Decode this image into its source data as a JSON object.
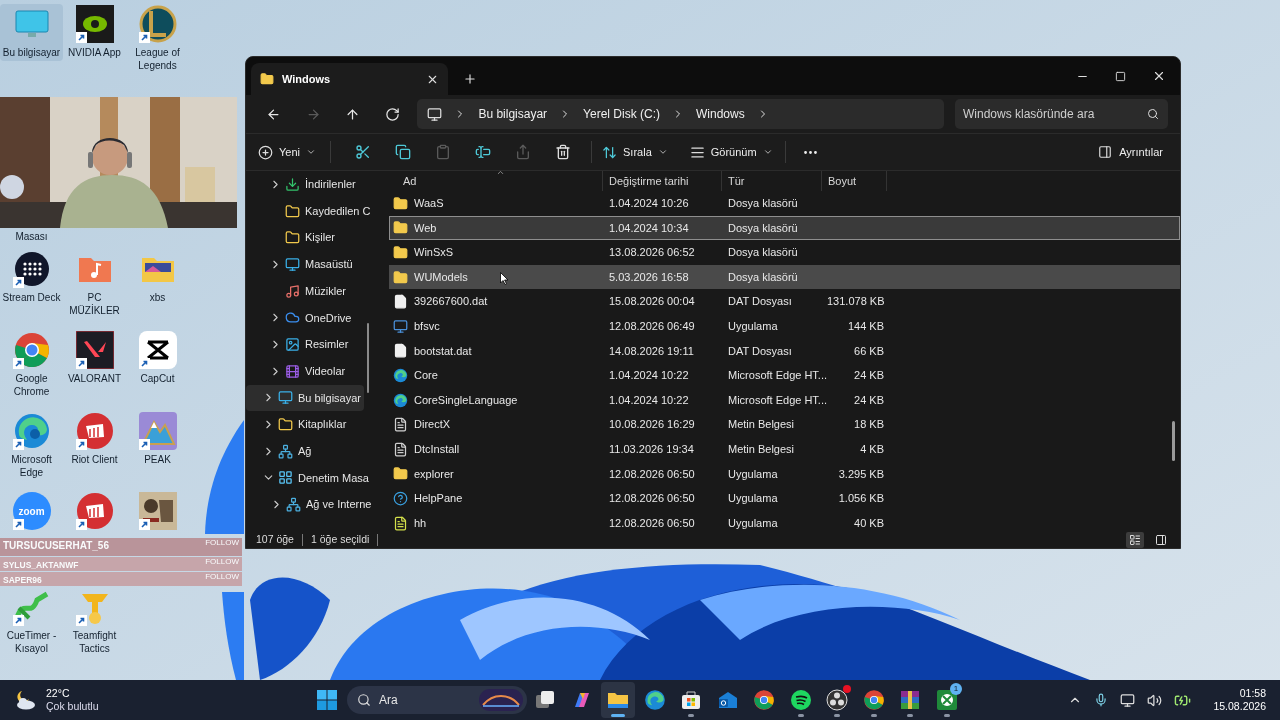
{
  "desktop": {
    "rows": [
      {
        "icons": [
          {
            "label": "Bu bilgisayar",
            "kind": "monitor",
            "shortcut": false,
            "selected": true
          },
          {
            "label": "NVIDIA App",
            "kind": "nvidia",
            "shortcut": true,
            "selected": false
          },
          {
            "label": "League of Legends",
            "kind": "emblem",
            "shortcut": true,
            "selected": false
          }
        ]
      },
      {
        "icons": []
      },
      {
        "icons": [
          {
            "label": "Masası",
            "kind": "none"
          }
        ]
      },
      {
        "icons": [
          {
            "label": "Stream Deck",
            "kind": "dotgrid",
            "shortcut": true,
            "selected": false
          },
          {
            "label": "PC MÜZİKLER",
            "kind": "musicfolder",
            "shortcut": false,
            "selected": false
          },
          {
            "label": "xbs",
            "kind": "imagefolder",
            "shortcut": false,
            "selected": false
          }
        ]
      },
      {
        "icons": [
          {
            "label": "Google Chrome",
            "kind": "chrome",
            "shortcut": true,
            "selected": false
          },
          {
            "label": "VALORANT",
            "kind": "valorant",
            "shortcut": true,
            "selected": false
          },
          {
            "label": "CapCut",
            "kind": "capcut",
            "shortcut": true,
            "selected": false
          }
        ]
      },
      {
        "icons": [
          {
            "label": "Microsoft Edge",
            "kind": "edge",
            "shortcut": true,
            "selected": false
          },
          {
            "label": "Riot Client",
            "kind": "riot",
            "shortcut": true,
            "selected": false
          },
          {
            "label": "PEAK",
            "kind": "mountain",
            "shortcut": true,
            "selected": false
          }
        ]
      },
      {
        "icons": [
          {
            "kind": "zoom",
            "logo_text": "zoom",
            "shortcut": true,
            "selected": false
          },
          {
            "kind": "riot",
            "shortcut": true,
            "selected": false
          },
          {
            "kind": "gameart",
            "shortcut": true,
            "selected": false
          }
        ]
      },
      {
        "icons": [
          {
            "label": "CueTimer - Kısayol",
            "kind": "cuetimer",
            "shortcut": true,
            "selected": false
          },
          {
            "label": "Teamfight Tactics",
            "kind": "goldlogo",
            "shortcut": true,
            "selected": false
          }
        ]
      }
    ]
  },
  "follow_alerts": [
    {
      "name": "TURSUCUSERHAT_56",
      "action": "FOLLOW"
    },
    {
      "name": "SYLUS_AKTANWF",
      "action": "FOLLOW"
    },
    {
      "name": "SAPER96",
      "action": "FOLLOW"
    }
  ],
  "explorer": {
    "tab": {
      "title": "Windows"
    },
    "nav_buttons": [
      {
        "kind": "back",
        "disabled": false
      },
      {
        "kind": "forward",
        "disabled": true
      },
      {
        "kind": "up",
        "disabled": false
      },
      {
        "kind": "refresh",
        "disabled": false
      }
    ],
    "breadcrumb": [
      "Bu bilgisayar",
      "Yerel Disk (C:)",
      "Windows"
    ],
    "search": {
      "placeholder": "Windows klasöründe ara"
    },
    "toolbar": {
      "new": "Yeni",
      "tools": [
        {
          "kind": "cut",
          "disabled": false
        },
        {
          "kind": "copy",
          "disabled": false
        },
        {
          "kind": "paste",
          "disabled": true
        },
        {
          "kind": "rename",
          "disabled": false
        },
        {
          "kind": "share",
          "disabled": true
        },
        {
          "kind": "delete",
          "disabled": false
        }
      ],
      "sort": "Sırala",
      "view": "Görünüm",
      "details": "Ayrıntılar"
    },
    "nav_pane": {
      "pinned": [
        {
          "label": "İndirilenler",
          "kind": "download",
          "expandable": true,
          "expanded": false,
          "selected": false
        },
        {
          "label": "Kaydedilen C",
          "kind": "folder",
          "expandable": false,
          "selected": false
        },
        {
          "label": "Kişiler",
          "kind": "folder",
          "expandable": false,
          "selected": false
        },
        {
          "label": "Masaüstü",
          "kind": "desktop",
          "expandable": true,
          "expanded": false,
          "selected": false
        },
        {
          "label": "Müzikler",
          "kind": "music",
          "expandable": false,
          "selected": false
        },
        {
          "label": "OneDrive",
          "kind": "cloud",
          "expandable": true,
          "expanded": false,
          "selected": false
        },
        {
          "label": "Resimler",
          "kind": "pictures",
          "expandable": true,
          "expanded": false,
          "selected": false
        },
        {
          "label": "Videolar",
          "kind": "videos",
          "expandable": true,
          "expanded": false,
          "selected": false
        }
      ],
      "tree": [
        {
          "label": "Bu bilgisayar",
          "kind": "monitor",
          "expandable": true,
          "expanded": false,
          "selected": true
        },
        {
          "label": "Kitaplıklar",
          "kind": "folder",
          "expandable": true,
          "expanded": false,
          "selected": false
        },
        {
          "label": "Ağ",
          "kind": "network",
          "expandable": true,
          "expanded": false,
          "selected": false
        },
        {
          "label": "Denetim Masa",
          "kind": "control",
          "expandable": true,
          "expanded": true,
          "selected": false,
          "children": [
            {
              "label": "Ağ ve Interne",
              "kind": "network",
              "expandable": true,
              "expanded": false,
              "selected": false
            }
          ]
        }
      ]
    },
    "columns": [
      "Ad",
      "Değiştirme tarihi",
      "Tür",
      "Boyut"
    ],
    "rows": [
      {
        "name": "WaaS",
        "date": "1.04.2024 10:26",
        "type": "Dosya klasörü",
        "kind": "folder",
        "selected": false,
        "hovered": false
      },
      {
        "name": "Web",
        "date": "1.04.2024 10:34",
        "type": "Dosya klasörü",
        "kind": "folder",
        "selected": true,
        "hovered": false
      },
      {
        "name": "WinSxS",
        "date": "13.08.2026 06:52",
        "type": "Dosya klasörü",
        "kind": "folder",
        "selected": false,
        "hovered": false
      },
      {
        "name": "WUModels",
        "date": "5.03.2026 16:58",
        "type": "Dosya klasörü",
        "kind": "folder",
        "selected": false,
        "hovered": true
      },
      {
        "name": "392667600.dat",
        "date": "15.08.2026 00:04",
        "type": "DAT Dosyası",
        "size": "131.078 KB",
        "kind": "file",
        "selected": false,
        "hovered": false
      },
      {
        "name": "bfsvc",
        "date": "12.08.2026 06:49",
        "type": "Uygulama",
        "size": "144 KB",
        "kind": "app",
        "selected": false,
        "hovered": false
      },
      {
        "name": "bootstat.dat",
        "date": "14.08.2026 19:11",
        "type": "DAT Dosyası",
        "size": "66 KB",
        "kind": "file",
        "selected": false,
        "hovered": false
      },
      {
        "name": "Core",
        "date": "1.04.2024 10:22",
        "type": "Microsoft Edge HT...",
        "size": "24 KB",
        "kind": "edge",
        "selected": false,
        "hovered": false
      },
      {
        "name": "CoreSingleLanguage",
        "date": "1.04.2024 10:22",
        "type": "Microsoft Edge HT...",
        "size": "24 KB",
        "kind": "edge",
        "selected": false,
        "hovered": false
      },
      {
        "name": "DirectX",
        "date": "10.08.2026 16:29",
        "type": "Metin Belgesi",
        "size": "18 KB",
        "kind": "text",
        "selected": false,
        "hovered": false
      },
      {
        "name": "DtcInstall",
        "date": "11.03.2026 19:34",
        "type": "Metin Belgesi",
        "size": "4 KB",
        "kind": "text",
        "selected": false,
        "hovered": false
      },
      {
        "name": "explorer",
        "date": "12.08.2026 06:50",
        "type": "Uygulama",
        "size": "3.295 KB",
        "kind": "explorer",
        "selected": false,
        "hovered": false
      },
      {
        "name": "HelpPane",
        "date": "12.08.2026 06:50",
        "type": "Uygulama",
        "size": "1.056 KB",
        "kind": "help",
        "selected": false,
        "hovered": false
      },
      {
        "name": "hh",
        "date": "12.08.2026 06:50",
        "type": "Uygulama",
        "size": "40 KB",
        "kind": "script",
        "selected": false,
        "hovered": false
      }
    ],
    "status": {
      "count": "107 öğe",
      "selection": "1 öğe seçildi"
    },
    "view_modes": [
      {
        "kind": "details",
        "selected": true
      },
      {
        "kind": "tiles",
        "selected": false
      }
    ]
  },
  "taskbar": {
    "weather": {
      "temperature": "22°C",
      "condition": "Çok bulutlu"
    },
    "search": {
      "placeholder": "Ara"
    },
    "apps": [
      {
        "kind": "start"
      },
      {
        "kind": "taskview",
        "running": false,
        "active": false
      },
      {
        "kind": "copilot",
        "running": false,
        "active": false
      },
      {
        "kind": "explorer",
        "running": true,
        "active": true
      },
      {
        "kind": "edge",
        "running": false,
        "active": false
      },
      {
        "kind": "store",
        "running": true,
        "active": false
      },
      {
        "kind": "mail",
        "running": false,
        "active": false
      },
      {
        "kind": "chrome",
        "running": false,
        "active": false
      },
      {
        "kind": "spotify",
        "running": true,
        "active": false
      },
      {
        "kind": "obs",
        "running": true,
        "active": false,
        "notification": true
      },
      {
        "kind": "chrome",
        "running": true,
        "active": false
      },
      {
        "kind": "winrar",
        "running": true,
        "active": false
      },
      {
        "kind": "xbox",
        "running": true,
        "active": false,
        "badge": "1"
      }
    ],
    "clock": {
      "time": "01:58",
      "date": "15.08.2026"
    }
  }
}
